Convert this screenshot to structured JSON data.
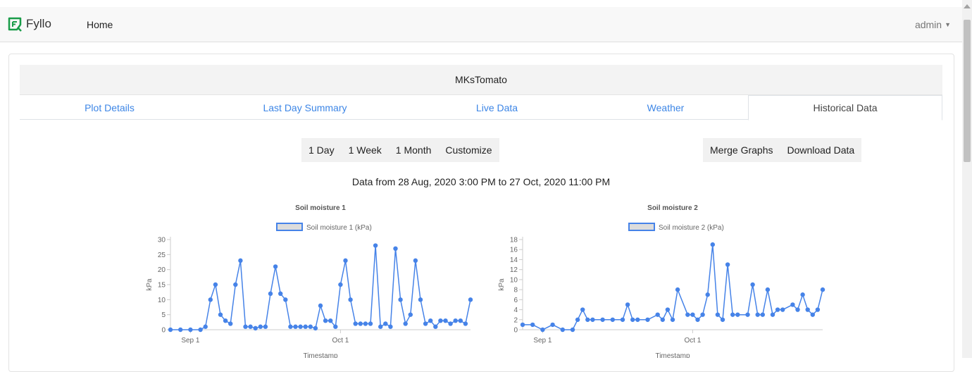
{
  "navbar": {
    "brand": "Fyllo",
    "home": "Home",
    "user": "admin"
  },
  "plot": {
    "name": "MKsTomato"
  },
  "tabs": [
    {
      "label": "Plot Details",
      "active": false
    },
    {
      "label": "Last Day Summary",
      "active": false
    },
    {
      "label": "Live Data",
      "active": false
    },
    {
      "label": "Weather",
      "active": false
    },
    {
      "label": "Historical Data",
      "active": true
    }
  ],
  "range_buttons": [
    "1 Day",
    "1 Week",
    "1 Month",
    "Customize"
  ],
  "action_buttons": [
    "Merge Graphs",
    "Download Data"
  ],
  "date_range_text": "Data from 28 Aug, 2020 3:00 PM to 27 Oct, 2020 11:00 PM",
  "colors": {
    "accent": "#3d86e6",
    "series": "#4683e8",
    "brand": "#1a9c49"
  },
  "icons": [
    "fyllo-logo-icon",
    "caret-down-icon"
  ],
  "chart_data": [
    {
      "type": "scatter",
      "title": "Soil moisture 1",
      "legend": "Soil moisture 1 (kPa)",
      "legend_position": "top",
      "xlabel": "Timestamp",
      "ylabel": "kPa",
      "x_ticks": [
        "Sep 1",
        "Oct 1"
      ],
      "x_range": [
        "2020-08-28",
        "2020-10-27"
      ],
      "ylim": [
        0,
        30
      ],
      "y_ticks": [
        0,
        5,
        10,
        15,
        20,
        25,
        30
      ],
      "grid": false,
      "series": [
        {
          "name": "Soil moisture 1 (kPa)",
          "x": [
            "2020-08-28",
            "2020-08-30",
            "2020-09-01",
            "2020-09-03",
            "2020-09-04",
            "2020-09-05",
            "2020-09-06",
            "2020-09-07",
            "2020-09-08",
            "2020-09-09",
            "2020-09-10",
            "2020-09-11",
            "2020-09-12",
            "2020-09-13",
            "2020-09-14",
            "2020-09-15",
            "2020-09-16",
            "2020-09-17",
            "2020-09-18",
            "2020-09-19",
            "2020-09-20",
            "2020-09-21",
            "2020-09-22",
            "2020-09-23",
            "2020-09-24",
            "2020-09-25",
            "2020-09-26",
            "2020-09-27",
            "2020-09-28",
            "2020-09-29",
            "2020-09-30",
            "2020-10-01",
            "2020-10-02",
            "2020-10-03",
            "2020-10-04",
            "2020-10-05",
            "2020-10-06",
            "2020-10-07",
            "2020-10-08",
            "2020-10-09",
            "2020-10-10",
            "2020-10-11",
            "2020-10-12",
            "2020-10-13",
            "2020-10-14",
            "2020-10-15",
            "2020-10-16",
            "2020-10-17",
            "2020-10-18",
            "2020-10-19",
            "2020-10-20",
            "2020-10-21",
            "2020-10-22",
            "2020-10-23",
            "2020-10-24",
            "2020-10-25",
            "2020-10-26",
            "2020-10-27"
          ],
          "y": [
            0,
            0,
            0,
            0,
            1,
            10,
            15,
            5,
            3,
            2,
            15,
            23,
            1,
            1,
            0.5,
            1,
            1,
            12,
            21,
            12,
            10,
            1,
            1,
            1,
            1,
            1,
            0.5,
            8,
            3,
            3,
            1,
            15,
            23,
            10,
            2,
            2,
            2,
            2,
            28,
            1,
            2,
            1,
            27,
            10,
            2,
            5,
            23,
            10,
            2,
            3,
            1,
            3,
            3,
            2,
            3,
            3,
            2,
            10
          ]
        }
      ]
    },
    {
      "type": "scatter",
      "title": "Soil moisture 2",
      "legend": "Soil moisture 2 (kPa)",
      "legend_position": "top",
      "xlabel": "Timestamp",
      "ylabel": "kPa",
      "x_ticks": [
        "Sep 1",
        "Oct 1"
      ],
      "x_range": [
        "2020-08-28",
        "2020-10-27"
      ],
      "ylim": [
        0,
        18
      ],
      "y_ticks": [
        0,
        2,
        4,
        6,
        8,
        10,
        12,
        14,
        16,
        18
      ],
      "grid": false,
      "series": [
        {
          "name": "Soil moisture 2 (kPa)",
          "x": [
            "2020-08-28",
            "2020-08-30",
            "2020-09-01",
            "2020-09-03",
            "2020-09-05",
            "2020-09-07",
            "2020-09-08",
            "2020-09-09",
            "2020-09-10",
            "2020-09-11",
            "2020-09-13",
            "2020-09-15",
            "2020-09-17",
            "2020-09-18",
            "2020-09-19",
            "2020-09-20",
            "2020-09-22",
            "2020-09-24",
            "2020-09-25",
            "2020-09-26",
            "2020-09-27",
            "2020-09-28",
            "2020-09-30",
            "2020-10-01",
            "2020-10-02",
            "2020-10-03",
            "2020-10-04",
            "2020-10-05",
            "2020-10-06",
            "2020-10-07",
            "2020-10-08",
            "2020-10-09",
            "2020-10-10",
            "2020-10-12",
            "2020-10-13",
            "2020-10-14",
            "2020-10-15",
            "2020-10-16",
            "2020-10-17",
            "2020-10-18",
            "2020-10-19",
            "2020-10-21",
            "2020-10-22",
            "2020-10-23",
            "2020-10-24",
            "2020-10-25",
            "2020-10-26",
            "2020-10-27"
          ],
          "y": [
            1,
            1,
            0,
            1,
            0,
            0,
            2,
            4,
            2,
            2,
            2,
            2,
            2,
            5,
            2,
            2,
            2,
            3,
            2,
            4,
            2,
            8,
            3,
            3,
            2,
            3,
            7,
            17,
            3,
            2,
            13,
            3,
            3,
            3,
            9,
            3,
            3,
            8,
            3,
            4,
            4,
            5,
            4,
            7,
            4,
            3,
            4,
            8
          ]
        }
      ]
    }
  ]
}
